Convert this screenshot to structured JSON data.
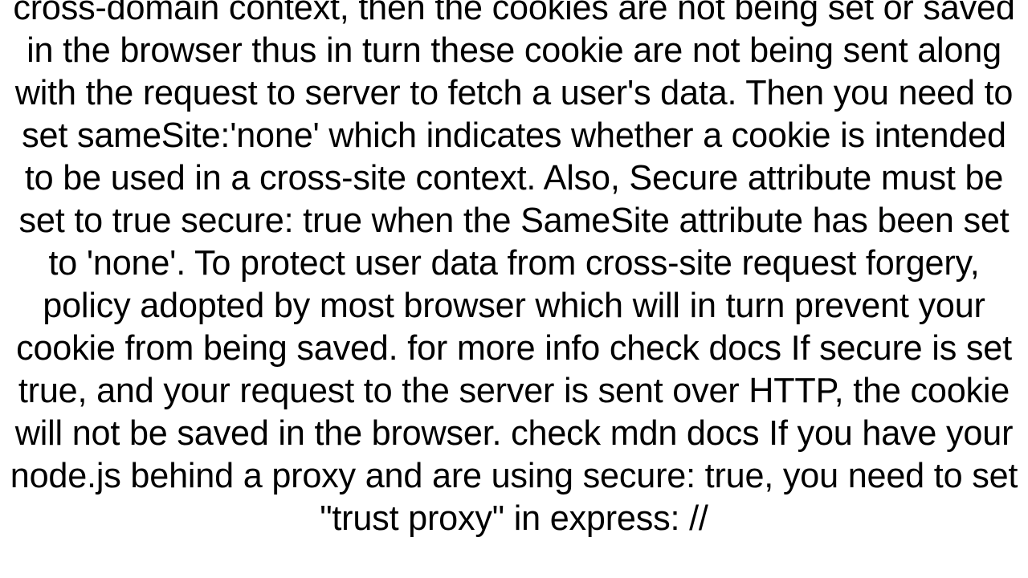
{
  "document": {
    "body": "cross-domain context, then the cookies are not being set or saved in the browser thus in turn these cookie are not being sent along with the request to server to fetch a user's data.   Then you need to set sameSite:'none' which indicates whether a cookie is intended to be used in a cross-site context. Also, Secure attribute must be set to true secure: true when the SameSite attribute has been set to 'none'. To protect user data from cross-site request forgery, policy adopted by most browser which will in turn prevent your cookie from being saved. for more info check docs  If secure is set true, and your request to the server is sent over HTTP, the cookie will not be saved in the browser. check mdn docs  If you have your node.js behind a proxy and are using secure: true, you need to set \"trust proxy\" in express:  //"
  }
}
